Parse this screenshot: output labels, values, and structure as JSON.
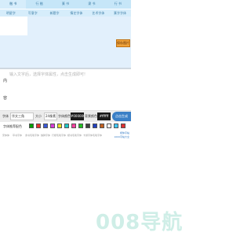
{
  "tabs_row1": [
    "楷 书",
    "行 楷",
    "篆 书",
    "隶 书",
    "行 书"
  ],
  "tabs_row2": [
    "明星字",
    "写意字",
    "新题字",
    "情艺字体",
    "艺术字体",
    "篆字字体"
  ],
  "preview": {
    "save_label": "保存图片"
  },
  "input": {
    "label_line1": "内",
    "label_line2": "容",
    "placeholder": "输入文字后，选择字体属性，点击生成即可!"
  },
  "controls": {
    "font_label": "字体",
    "font_value": "华文三角",
    "size_label": "大小",
    "size_value": "24像素",
    "font_color_label": "字体颜色",
    "font_color_value": "#000000",
    "bg_color_label": "背景颜色",
    "bg_color_value": "#ffffff",
    "generate_label": "点击生成"
  },
  "color_row": {
    "label": "字体推荐配色",
    "swatches": [
      "#00a000",
      "#e83030",
      "#3a5ad8",
      "#d83ad8",
      "#e8e020",
      "#20c8c8",
      "#ff40a0",
      "#20c020",
      "#404040",
      "#2040c0",
      "#c06020",
      "#ffffff",
      "#40c8ff",
      "#e03030"
    ]
  },
  "hints": [
    "宋体体",
    "草书字体",
    "隶书毛笔字体",
    "魏碑字体",
    "行楷毛笔字体",
    "楷书毛笔字体",
    "卡通字体毛笔字体"
  ],
  "hint_links": [
    "楷体字帖",
    "1000字帖大全"
  ],
  "watermark": "008导航",
  "colors": {
    "accent": "#3a7fc6",
    "save_button": "#f0a33a",
    "tab_bg": "#c6e6f8"
  }
}
